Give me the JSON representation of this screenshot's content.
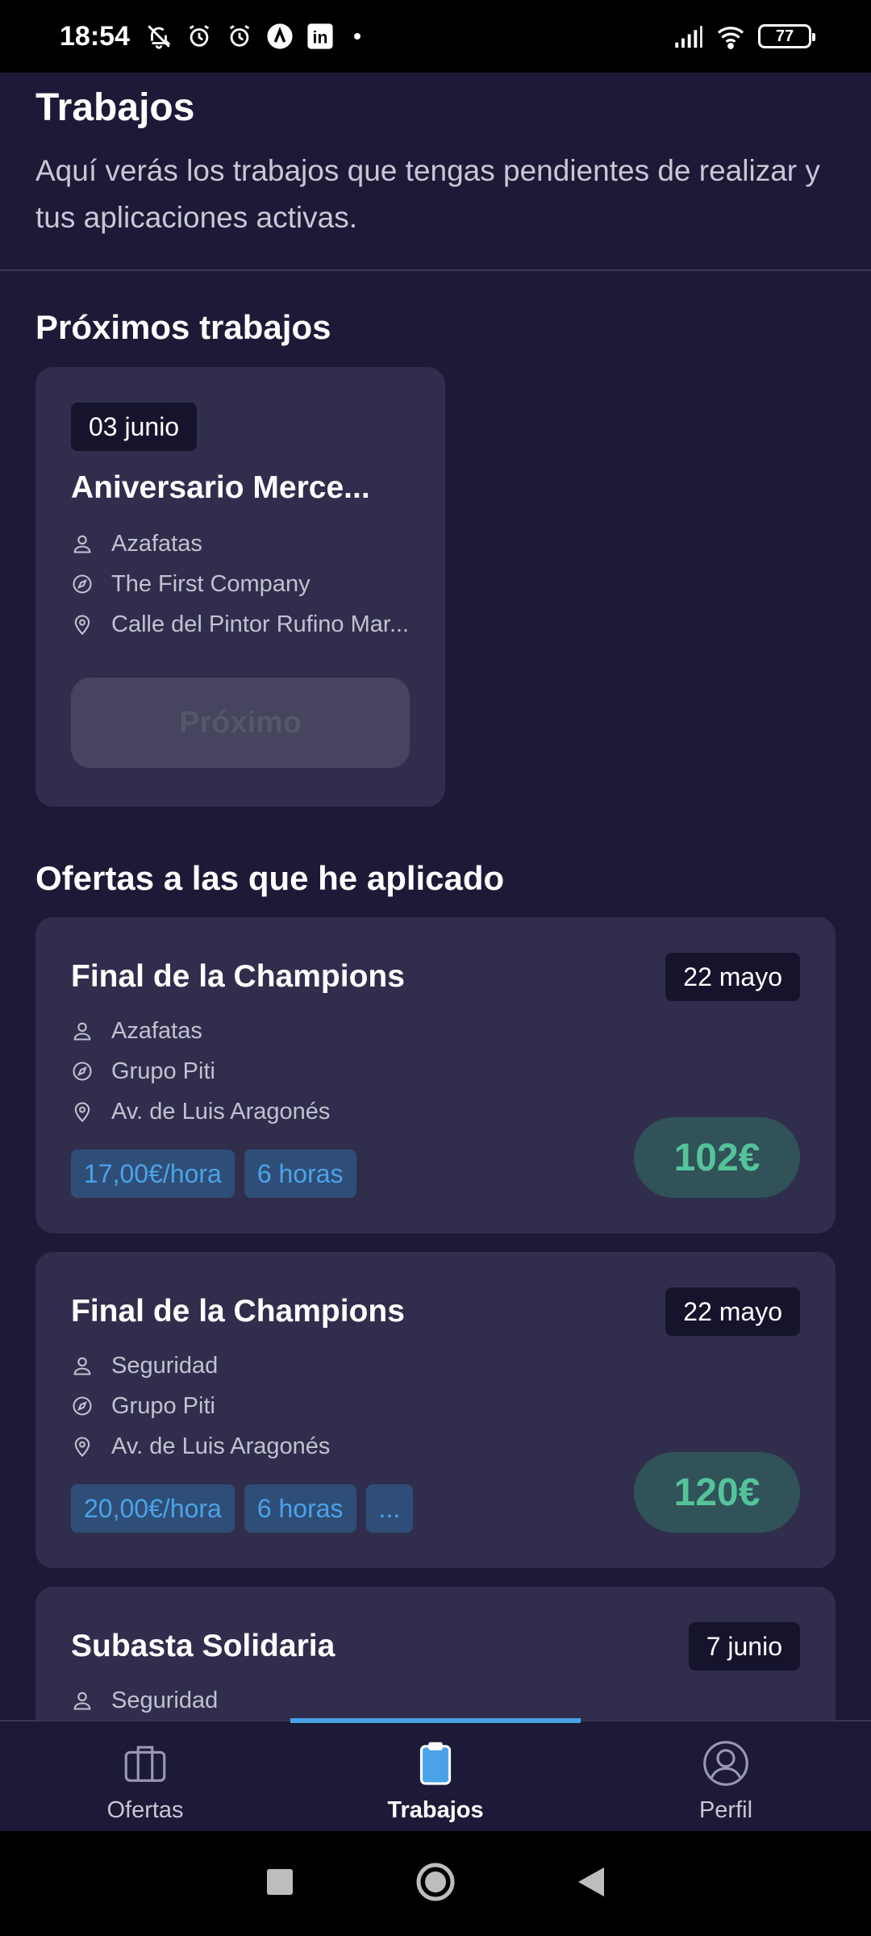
{
  "status_bar": {
    "time": "18:54",
    "icons": [
      "bell-off-icon",
      "alarm-icon",
      "alarm-icon",
      "app-a-icon",
      "linkedin-icon"
    ],
    "linkedin_text": "in",
    "battery": "77"
  },
  "header": {
    "title": "Trabajos",
    "subtitle": "Aquí verás los trabajos que tengas pendientes de realizar y tus aplicaciones activas."
  },
  "upcoming": {
    "section_title": "Próximos trabajos",
    "card": {
      "date": "03 junio",
      "title": "Aniversario Merce...",
      "role": "Azafatas",
      "company": "The First Company",
      "location": "Calle del Pintor Rufino Mar...",
      "button_label": "Próximo"
    }
  },
  "applied": {
    "section_title": "Ofertas a las que he aplicado",
    "cards": [
      {
        "title": "Final de la Champions",
        "date": "22 mayo",
        "role": "Azafatas",
        "company": "Grupo Piti",
        "location": "Av. de Luis Aragonés",
        "tags": [
          "17,00€/hora",
          "6 horas"
        ],
        "price": "102€"
      },
      {
        "title": "Final de la Champions",
        "date": "22 mayo",
        "role": "Seguridad",
        "company": "Grupo Piti",
        "location": "Av. de Luis Aragonés",
        "tags": [
          "20,00€/hora",
          "6 horas",
          "..."
        ],
        "price": "120€"
      },
      {
        "title": "Subasta Solidaria",
        "date": "7 junio",
        "role": "Seguridad"
      }
    ]
  },
  "bottom_nav": {
    "items": [
      {
        "label": "Ofertas",
        "icon": "briefcase-icon"
      },
      {
        "label": "Trabajos",
        "icon": "clipboard-icon",
        "active": true
      },
      {
        "label": "Perfil",
        "icon": "user-circle-icon"
      }
    ]
  },
  "colors": {
    "background": "#1c1a36",
    "card": "#302e4c",
    "accent": "#4aa3e8",
    "price": "#55c39a"
  }
}
